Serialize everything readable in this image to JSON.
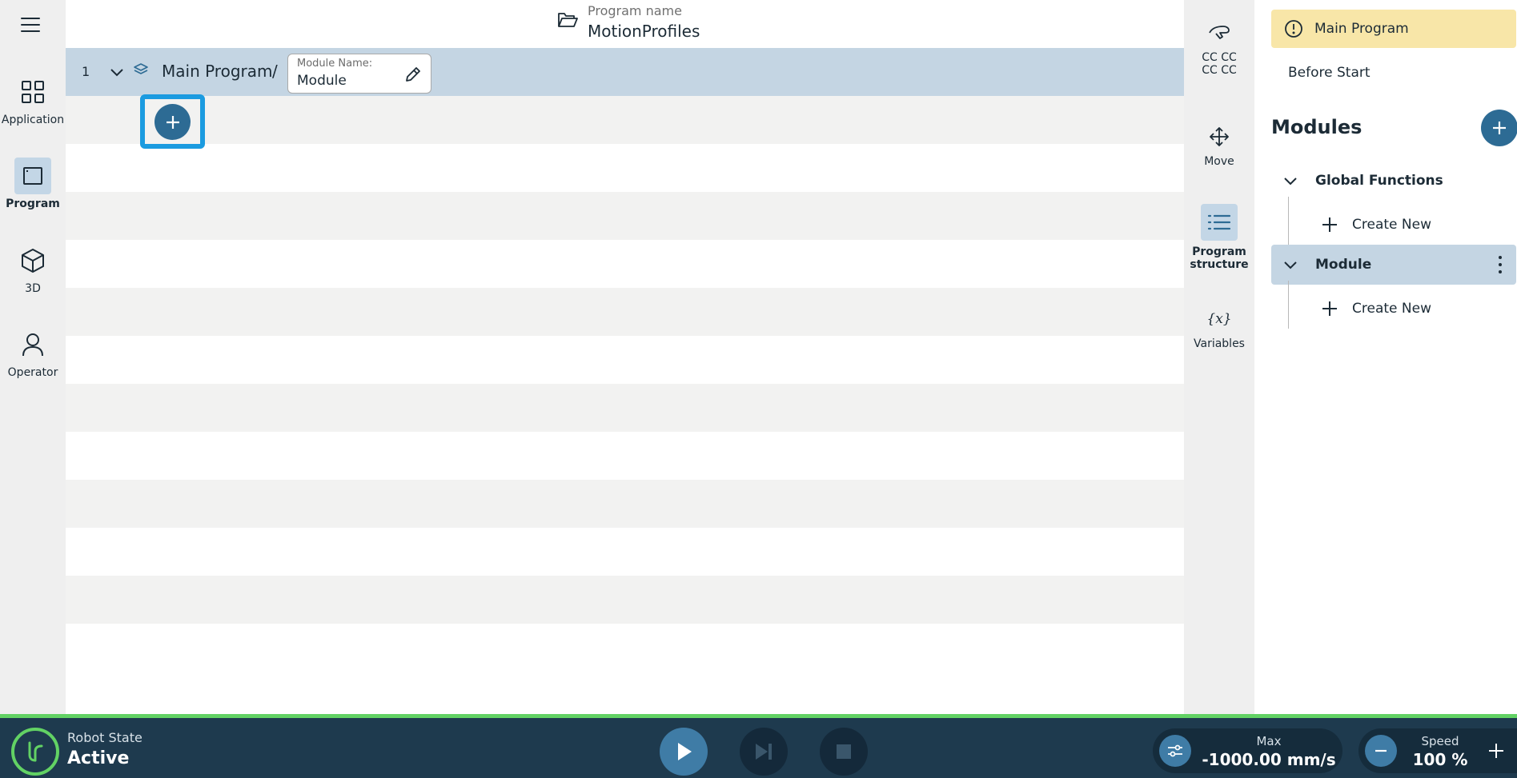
{
  "nav": {
    "items": [
      {
        "label": "Application",
        "icon": "grid-icon"
      },
      {
        "label": "Program",
        "icon": "window-icon"
      },
      {
        "label": "3D",
        "icon": "cube-icon"
      },
      {
        "label": "Operator",
        "icon": "person-icon"
      }
    ],
    "active": "Program"
  },
  "header": {
    "program_name_label": "Program name",
    "program_name": "MotionProfiles"
  },
  "program": {
    "line_number": "1",
    "main_title": "Main Program",
    "separator": "/",
    "module_field_label": "Module Name:",
    "module_field_value": "Module"
  },
  "tools": {
    "items": [
      {
        "label_line1": "CC CC",
        "label_line2": "CC CC",
        "icon": "hand-icon"
      },
      {
        "label_line1": "Move",
        "label_line2": "",
        "icon": "move-icon"
      },
      {
        "label_line1": "Program",
        "label_line2": "structure",
        "icon": "list-icon"
      },
      {
        "label_line1": "Variables",
        "label_line2": "",
        "icon": "variables-icon"
      }
    ],
    "variables_glyph": "{x}"
  },
  "panel": {
    "main_program": "Main Program",
    "before_start": "Before Start",
    "modules_title": "Modules",
    "tree": [
      {
        "label": "Global Functions",
        "create": "Create New"
      },
      {
        "label": "Module",
        "create": "Create New"
      }
    ]
  },
  "bottom": {
    "robot_state_label": "Robot State",
    "robot_state_value": "Active",
    "max_label": "Max",
    "max_value": "-1000.00 mm/s",
    "speed_label": "Speed",
    "speed_value": "100 %"
  },
  "colors": {
    "accent": "#2d6b94",
    "highlight": "#1b9be0",
    "selected_row": "#c4d5e3",
    "warning": "#f8e6a8",
    "bottom_bar": "#1e3a4e",
    "status_green": "#62d264"
  }
}
